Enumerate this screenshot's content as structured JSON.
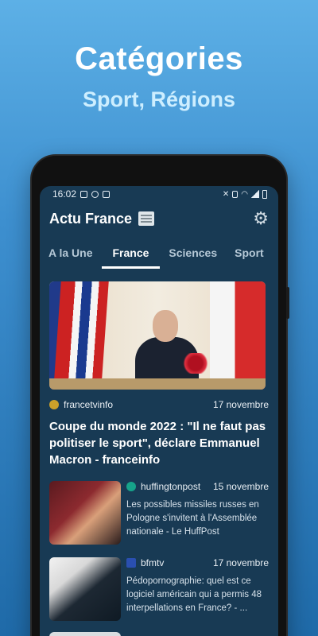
{
  "promo": {
    "title": "Catégories",
    "subtitle": "Sport, Régions"
  },
  "status_bar": {
    "time": "16:02",
    "left_icons": [
      "image-icon",
      "chat-icon",
      "app-icon"
    ],
    "right_icons": [
      "mute-icon",
      "alarm-icon",
      "wifi-icon",
      "signal-icon",
      "battery-icon"
    ]
  },
  "app_bar": {
    "title": "Actu France",
    "title_icon": "newspaper-icon",
    "settings_icon": "gear-icon"
  },
  "tabs": [
    {
      "label": "A la Une",
      "active": false
    },
    {
      "label": "France",
      "active": true
    },
    {
      "label": "Sciences",
      "active": false
    },
    {
      "label": "Sport",
      "active": false
    }
  ],
  "lead_article": {
    "source": "francetvinfo",
    "date": "17 novembre",
    "title": "Coupe du monde 2022 : \"Il ne faut pas politiser le sport\", déclare Emmanuel Macron - franceinfo",
    "source_color": "#caa02a"
  },
  "articles": [
    {
      "source": "huffingtonpost",
      "date": "15 novembre",
      "title": "Les possibles missiles russes en Pologne s'invitent à l'Assemblée nationale - Le HuffPost",
      "source_color": "#16a38a"
    },
    {
      "source": "bfmtv",
      "date": "17 novembre",
      "title": "Pédopornographie: quel est ce logiciel américain qui a permis 48 interpellations en France? - ...",
      "source_color": "#2a4fb0"
    }
  ],
  "colors": {
    "screen_bg": "#183a54",
    "active_tab_indicator": "#ffffff"
  }
}
